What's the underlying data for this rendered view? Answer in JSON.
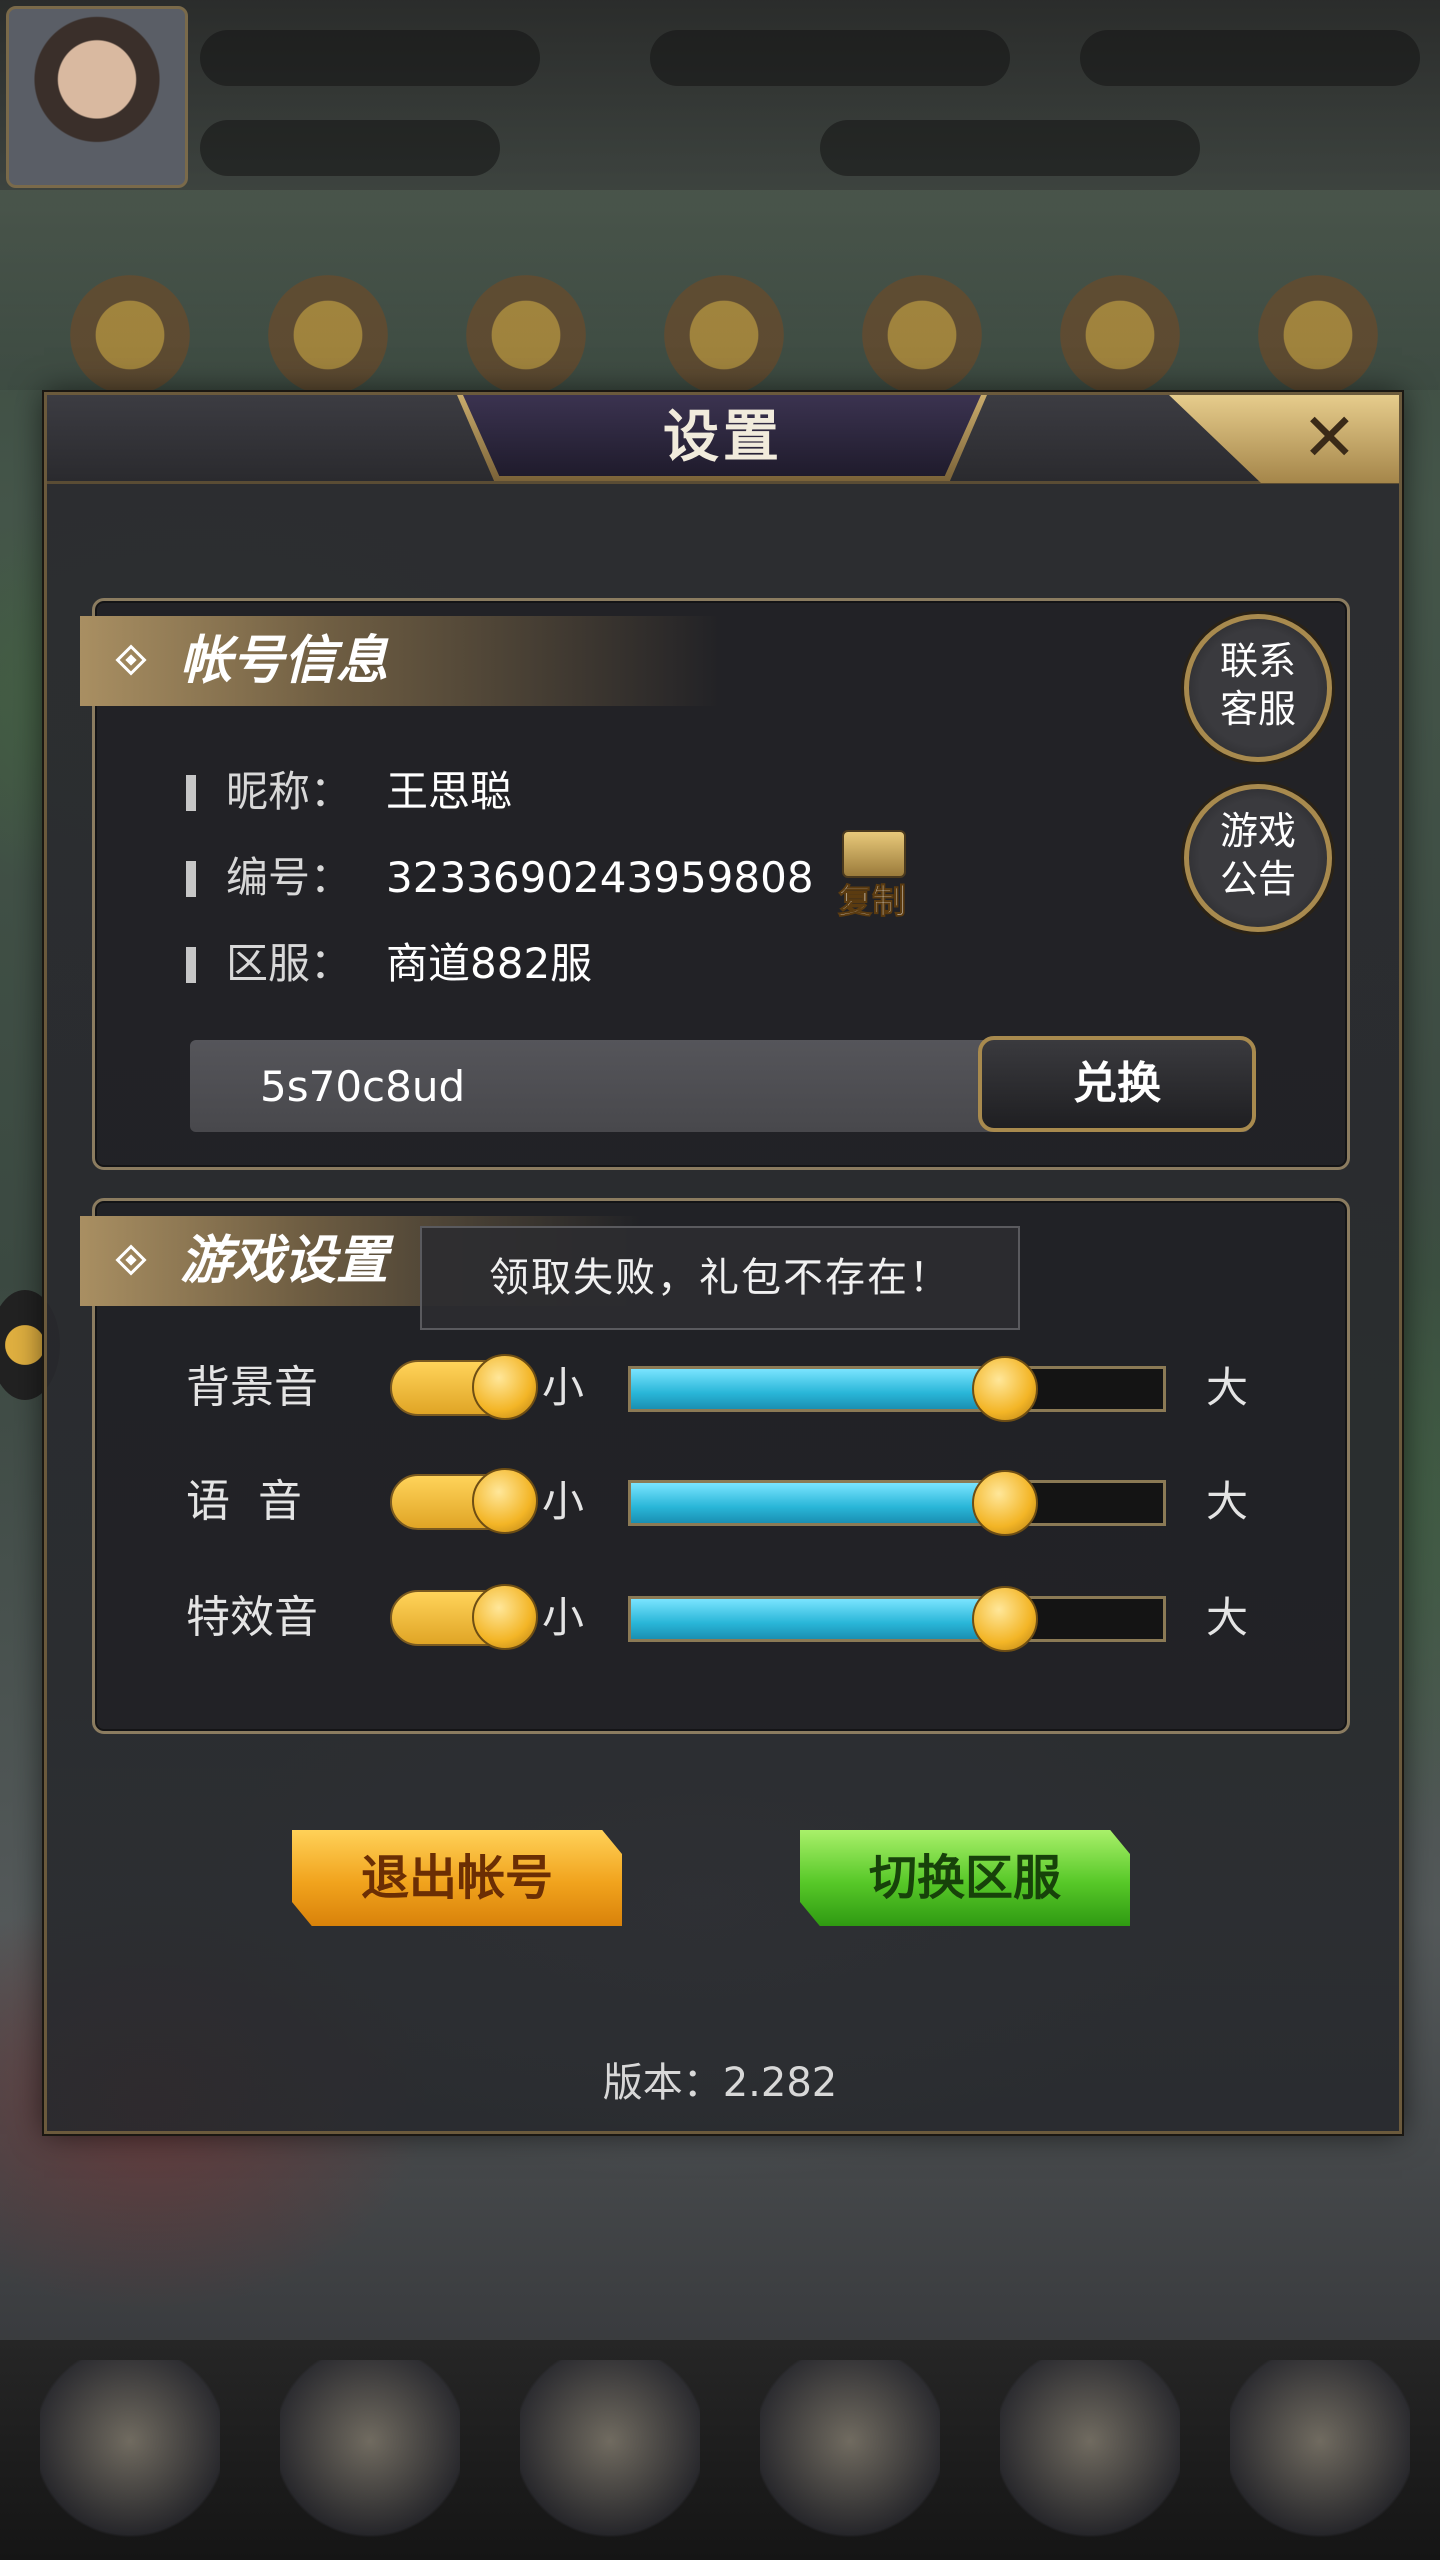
{
  "dialog": {
    "title": "设置",
    "close_label": "✕"
  },
  "account": {
    "section_title": "帐号信息",
    "contact_service": [
      "联系",
      "客服"
    ],
    "announcement": [
      "游戏",
      "公告"
    ],
    "nickname_label": "昵称：",
    "nickname": "王思聪",
    "id_label": "编号：",
    "id": "3233690243959808",
    "copy_label": "复制",
    "server_label": "区服：",
    "server": "商道882服",
    "redeem_code": "5s70c8ud",
    "redeem_button": "兑换"
  },
  "toast": {
    "message": "领取失败，礼包不存在！"
  },
  "game_settings": {
    "section_title": "游戏设置",
    "small_label": "小",
    "big_label": "大",
    "rows": [
      {
        "label": "背景音",
        "enabled": true,
        "level": 0.7
      },
      {
        "label": "语  音",
        "enabled": true,
        "level": 0.7
      },
      {
        "label": "特效音",
        "enabled": true,
        "level": 0.7
      }
    ]
  },
  "actions": {
    "logout": "退出帐号",
    "switch_server": "切换区服"
  },
  "version": "版本：2.282",
  "colors": {
    "accent_gold": "#a88a4e",
    "slider_fill": "#29b6d8",
    "logout_button": "#f1a31d",
    "switch_button": "#57c828"
  }
}
